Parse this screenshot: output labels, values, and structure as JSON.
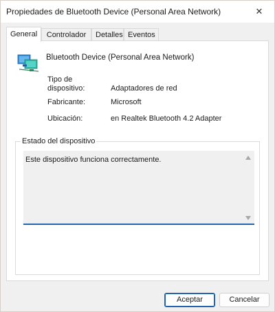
{
  "window": {
    "title": "Propiedades de Bluetooth Device (Personal Area Network)",
    "close_glyph": "✕"
  },
  "tabs": [
    {
      "label": "General",
      "active": true
    },
    {
      "label": "Controlador",
      "active": false
    },
    {
      "label": "Detalles",
      "active": false
    },
    {
      "label": "Eventos",
      "active": false
    }
  ],
  "device": {
    "icon": "network-adapter-icon",
    "name": "Bluetooth Device (Personal Area Network)"
  },
  "properties": [
    {
      "label": "Tipo de\ndispositivo:",
      "value": "Adaptadores de red"
    },
    {
      "label": "Fabricante:",
      "value": "Microsoft"
    },
    {
      "label": "Ubicación:",
      "value": "en Realtek Bluetooth 4.2 Adapter"
    }
  ],
  "status": {
    "group_label": "Estado del dispositivo",
    "text": "Este dispositivo funciona correctamente."
  },
  "buttons": {
    "accept": "Aceptar",
    "cancel": "Cancelar"
  },
  "colors": {
    "accent": "#1f63b1",
    "icon_teal": "#2bb5a7",
    "icon_blue": "#3a8fd6"
  }
}
